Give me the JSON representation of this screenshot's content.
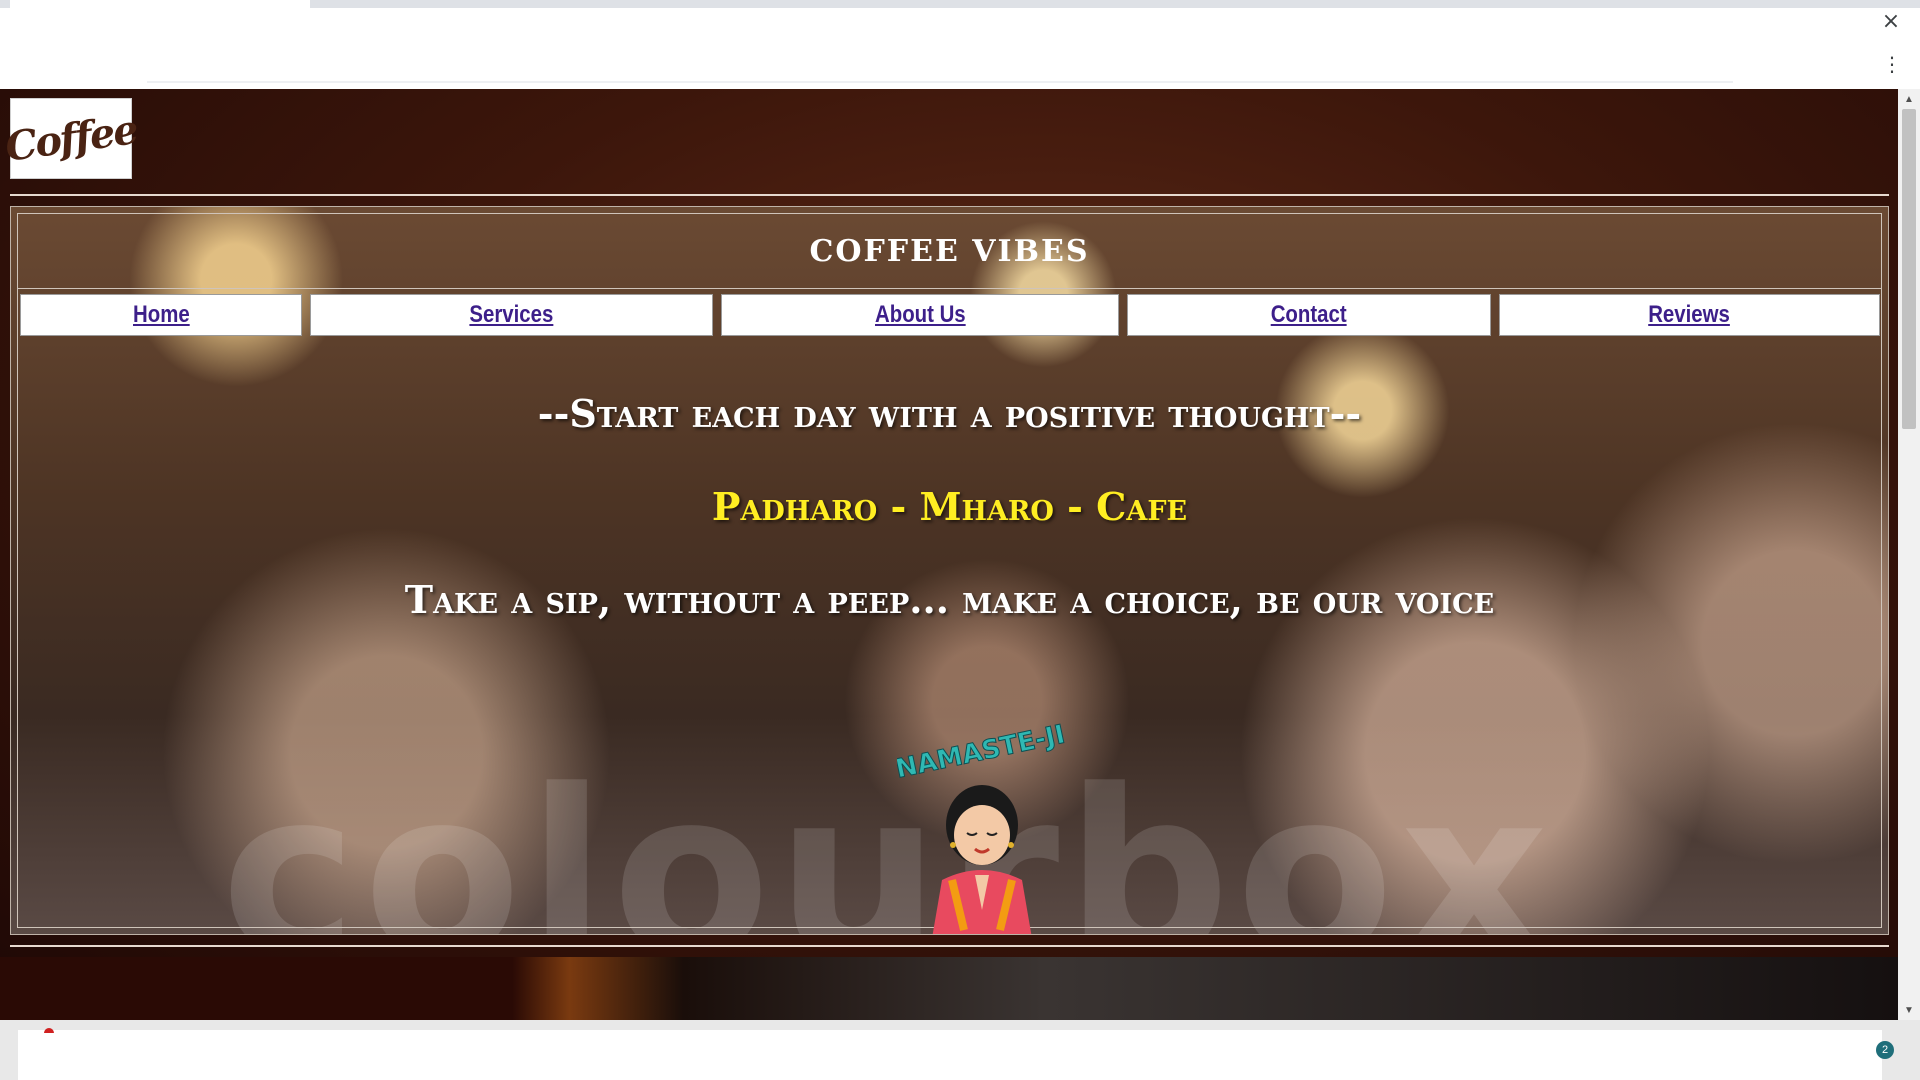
{
  "browser": {
    "close_icon": "×",
    "menu_icon": "⋮",
    "scroll_up_icon": "▲",
    "scroll_down_icon": "▼",
    "notification_count": "2"
  },
  "site": {
    "logo_text": "Coffee",
    "title": "COFFEE VIBES",
    "nav": [
      {
        "label": "Home"
      },
      {
        "label": "Services"
      },
      {
        "label": "About Us"
      },
      {
        "label": "Contact"
      },
      {
        "label": "Reviews"
      }
    ],
    "taglines": {
      "line1": "--Start each day with a positive thought--",
      "line2": "Padharo - Mharo - Cafe",
      "line3": "Take a sip, without a peep... make a choice, be our voice"
    },
    "sticker_text": "NAMASTE-JI",
    "watermark": "colourbox"
  },
  "colors": {
    "accent_yellow": "#ffee22",
    "nav_link": "#3d1f8a",
    "background_brown": "#3c160b"
  }
}
